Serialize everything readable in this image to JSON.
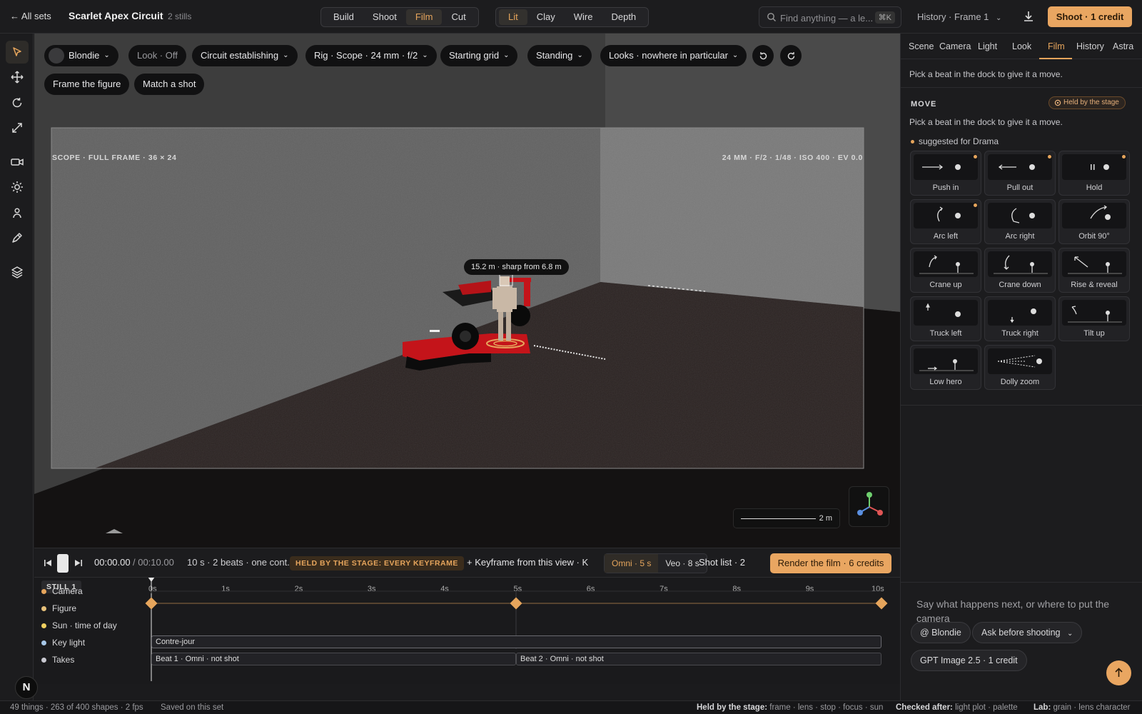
{
  "topbar": {
    "back_label": "← All sets",
    "title": "Scarlet Apex Circuit",
    "stills": "2 stills",
    "modes": [
      "Build",
      "Shoot",
      "Film",
      "Cut"
    ],
    "active_mode": "Film",
    "views": [
      "Lit",
      "Clay",
      "Wire",
      "Depth"
    ],
    "active_view": "Lit",
    "search_placeholder": "Find anything — a le...",
    "search_shortcut": "⌘K",
    "history": "History · Frame 1",
    "shoot_button": "Shoot · 1 credit"
  },
  "toolbar": {
    "tools": [
      "select-icon",
      "move-icon",
      "rotate-icon",
      "scale-icon",
      "camera-icon",
      "light-icon",
      "figure-icon",
      "measure-icon",
      "layers-icon"
    ],
    "active_tool": "select-icon"
  },
  "viewport": {
    "chips": {
      "figure": "Blondie",
      "look": "Look · Off",
      "shot": "Circuit establishing",
      "rig": "Rig · Scope · 24 mm · f/2",
      "position": "Starting grid",
      "pose": "Standing",
      "gaze": "Looks · nowhere in particular",
      "frame_figure": "Frame the figure",
      "match_shot": "Match a shot"
    },
    "scope_label": "SCOPE · FULL FRAME · 36 × 24",
    "exposure_label": "24 MM · F/2 · 1/48 · ISO 400 · EV 0.0",
    "focus_tip": "15.2 m · sharp from 6.8 m",
    "scale_label": "2 m"
  },
  "transport": {
    "time_current": "00:00.00",
    "time_total": "/ 00:10.00",
    "summary": "10 s · 2 beats · one cont...",
    "held_pill": "HELD BY THE STAGE: EVERY KEYFRAME",
    "keyframe": "+ Keyframe from this view · K",
    "engines": [
      "Omni · 5 s",
      "Veo · 8 s"
    ],
    "active_engine": "Omni · 5 s",
    "shot_list": "Shot list · 2",
    "render": "Render the film · 6 credits"
  },
  "timeline": {
    "still_label": "STILL 1",
    "ticks": [
      "0s",
      "1s",
      "2s",
      "3s",
      "4s",
      "5s",
      "6s",
      "7s",
      "8s",
      "9s",
      "10s"
    ],
    "tracks": [
      {
        "name": "Camera",
        "color": "#e6a55c"
      },
      {
        "name": "Figure",
        "color": "#e6c07a"
      },
      {
        "name": "Sun · time of day",
        "color": "#f0d060"
      },
      {
        "name": "Key light",
        "color": "#a8c8e8"
      },
      {
        "name": "Takes",
        "color": "#c8c8d0"
      }
    ],
    "keylight_clip": "Contre-jour",
    "takes": [
      "Beat 1 · Omni · not shot",
      "Beat 2 · Omni · not shot"
    ]
  },
  "panel": {
    "tabs": [
      "Scene",
      "Camera",
      "Light",
      "Look",
      "Film",
      "History",
      "Astra"
    ],
    "active_tab": "Film",
    "hint_top": "Pick a beat in the dock to give it a move.",
    "move_heading": "MOVE",
    "held_badge": "Held by the stage",
    "hint_move": "Pick a beat in the dock to give it a move.",
    "suggested": "suggested for Drama",
    "moves": [
      {
        "name": "Push in",
        "suggested": true
      },
      {
        "name": "Pull out",
        "suggested": true
      },
      {
        "name": "Hold",
        "suggested": true
      },
      {
        "name": "Arc left",
        "suggested": true
      },
      {
        "name": "Arc right",
        "suggested": false
      },
      {
        "name": "Orbit 90°",
        "suggested": false
      },
      {
        "name": "Crane up",
        "suggested": false
      },
      {
        "name": "Crane down",
        "suggested": false
      },
      {
        "name": "Rise & reveal",
        "suggested": false
      },
      {
        "name": "Truck left",
        "suggested": false
      },
      {
        "name": "Truck right",
        "suggested": false
      },
      {
        "name": "Tilt up",
        "suggested": false
      },
      {
        "name": "Low hero",
        "suggested": false
      },
      {
        "name": "Dolly zoom",
        "suggested": false
      }
    ]
  },
  "chat": {
    "placeholder": "Say what happens next, or where to put the camera",
    "mention": "@ Blondie",
    "mode": "Ask before shooting",
    "model": "GPT Image 2.5 · 1 credit"
  },
  "status": {
    "stats": "49 things · 263 of 400 shapes · 2 fps",
    "saved": "Saved on this set",
    "held_label": "Held by the stage:",
    "held_value": "frame · lens · stop · focus · sun",
    "checked_label": "Checked after:",
    "checked_value": "light plot · palette",
    "lab_label": "Lab:",
    "lab_value": "grain · lens character"
  },
  "badge": "N"
}
